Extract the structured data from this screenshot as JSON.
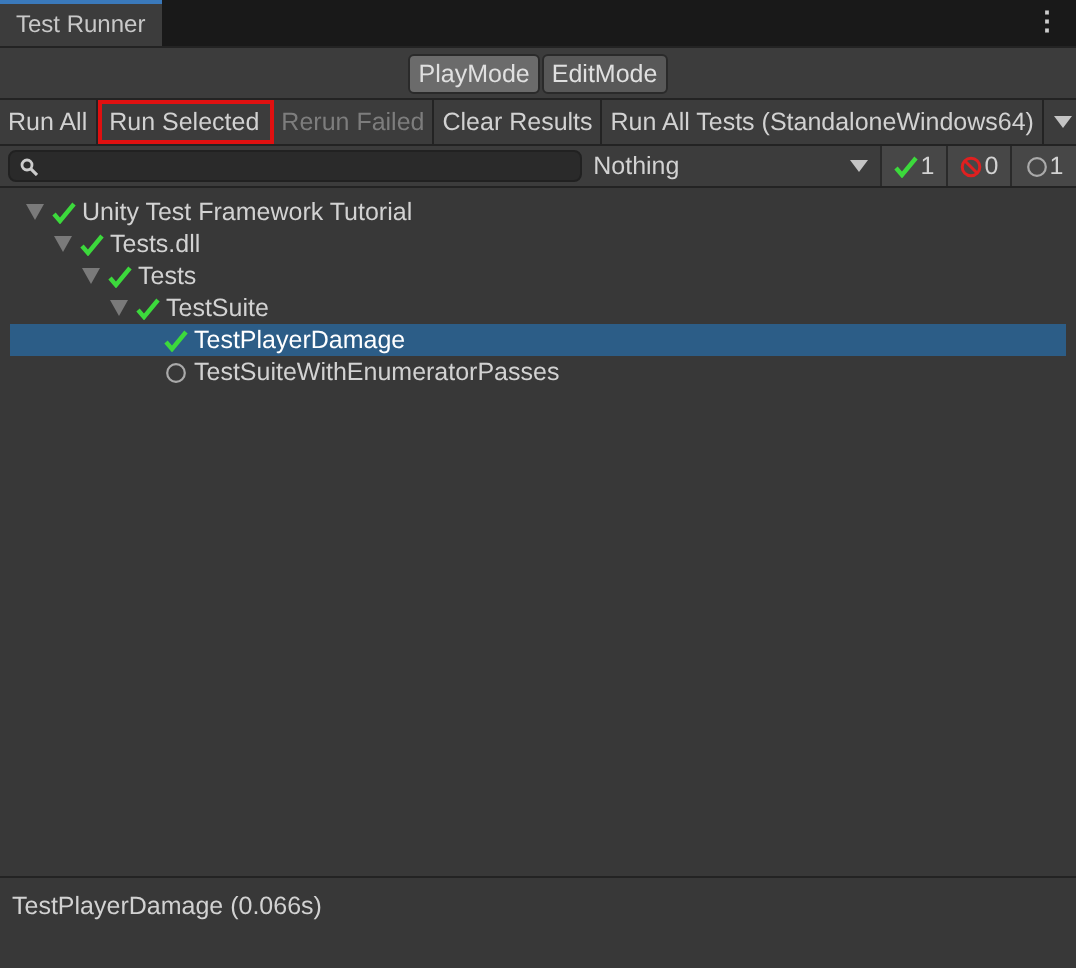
{
  "window": {
    "tab": "Test Runner",
    "menu": "⋮"
  },
  "modes": [
    {
      "label": "PlayMode",
      "selected": true
    },
    {
      "label": "EditMode",
      "selected": false
    }
  ],
  "toolbar": [
    {
      "label": "Run All",
      "disabled": false,
      "highlighted": false
    },
    {
      "label": "Run Selected",
      "disabled": false,
      "highlighted": true
    },
    {
      "label": "Rerun Failed",
      "disabled": true,
      "highlighted": false
    },
    {
      "label": "Clear Results",
      "disabled": false,
      "highlighted": false
    },
    {
      "label": "Run All Tests (StandaloneWindows64)",
      "disabled": false,
      "highlighted": false
    }
  ],
  "filter": {
    "category": "Nothing",
    "counts": [
      {
        "kind": "passed",
        "count": "1"
      },
      {
        "kind": "failed",
        "count": "0"
      },
      {
        "kind": "none",
        "count": "1"
      }
    ]
  },
  "tree": [
    {
      "label": "Unity Test Framework Tutorial",
      "kind": "passed",
      "expanded": true,
      "selected": false,
      "children": [
        {
          "label": "Tests.dll",
          "kind": "passed",
          "expanded": true,
          "selected": false,
          "children": [
            {
              "label": "Tests",
              "kind": "passed",
              "expanded": true,
              "selected": false,
              "children": [
                {
                  "label": "TestSuite",
                  "kind": "passed",
                  "expanded": true,
                  "selected": false,
                  "children": [
                    {
                      "label": "TestPlayerDamage",
                      "kind": "passed",
                      "selected": true
                    },
                    {
                      "label": "TestSuiteWithEnumeratorPasses",
                      "kind": "none",
                      "selected": false
                    }
                  ]
                }
              ]
            }
          ]
        }
      ]
    }
  ],
  "status_bar": "TestPlayerDamage (0.066s)"
}
